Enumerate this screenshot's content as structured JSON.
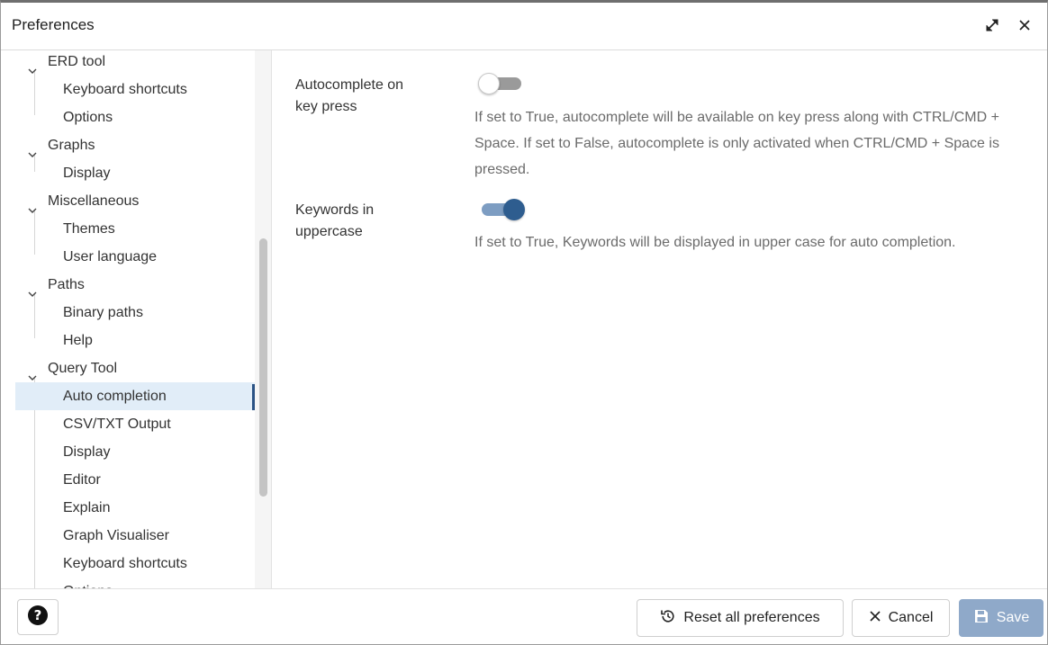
{
  "dialog": {
    "title": "Preferences",
    "maximize_icon": "expand-diagonal-icon",
    "close_icon": "close-icon"
  },
  "sidebar": {
    "items": [
      {
        "label": "ERD tool",
        "type": "parent",
        "expanded": true
      },
      {
        "label": "Keyboard shortcuts",
        "type": "child"
      },
      {
        "label": "Options",
        "type": "child"
      },
      {
        "label": "Graphs",
        "type": "parent",
        "expanded": true
      },
      {
        "label": "Display",
        "type": "child"
      },
      {
        "label": "Miscellaneous",
        "type": "parent",
        "expanded": true
      },
      {
        "label": "Themes",
        "type": "child"
      },
      {
        "label": "User language",
        "type": "child"
      },
      {
        "label": "Paths",
        "type": "parent",
        "expanded": true
      },
      {
        "label": "Binary paths",
        "type": "child"
      },
      {
        "label": "Help",
        "type": "child"
      },
      {
        "label": "Query Tool",
        "type": "parent",
        "expanded": true
      },
      {
        "label": "Auto completion",
        "type": "child",
        "selected": true
      },
      {
        "label": "CSV/TXT Output",
        "type": "child"
      },
      {
        "label": "Display",
        "type": "child"
      },
      {
        "label": "Editor",
        "type": "child"
      },
      {
        "label": "Explain",
        "type": "child"
      },
      {
        "label": "Graph Visualiser",
        "type": "child"
      },
      {
        "label": "Keyboard shortcuts",
        "type": "child"
      },
      {
        "label": "Options",
        "type": "child"
      }
    ]
  },
  "preferences": [
    {
      "label_line1": "Autocomplete on",
      "label_line2": "key press",
      "enabled": false,
      "description": "If set to True, autocomplete will be available on key press along with CTRL/CMD + Space. If set to False, autocomplete is only activated when CTRL/CMD + Space is pressed."
    },
    {
      "label_line1": "Keywords in",
      "label_line2": "uppercase",
      "enabled": true,
      "description": "If set to True, Keywords will be displayed in upper case for auto completion."
    }
  ],
  "footer": {
    "help_icon": "question-circle-icon",
    "reset_label": "Reset all preferences",
    "reset_icon": "reset-history-icon",
    "cancel_label": "Cancel",
    "cancel_icon": "close-icon",
    "save_label": "Save",
    "save_icon": "floppy-disk-icon"
  },
  "colors": {
    "accent": "#2e5d8f",
    "selected_bg": "#e1edf8",
    "save_disabled_bg": "#8fa9c9"
  }
}
